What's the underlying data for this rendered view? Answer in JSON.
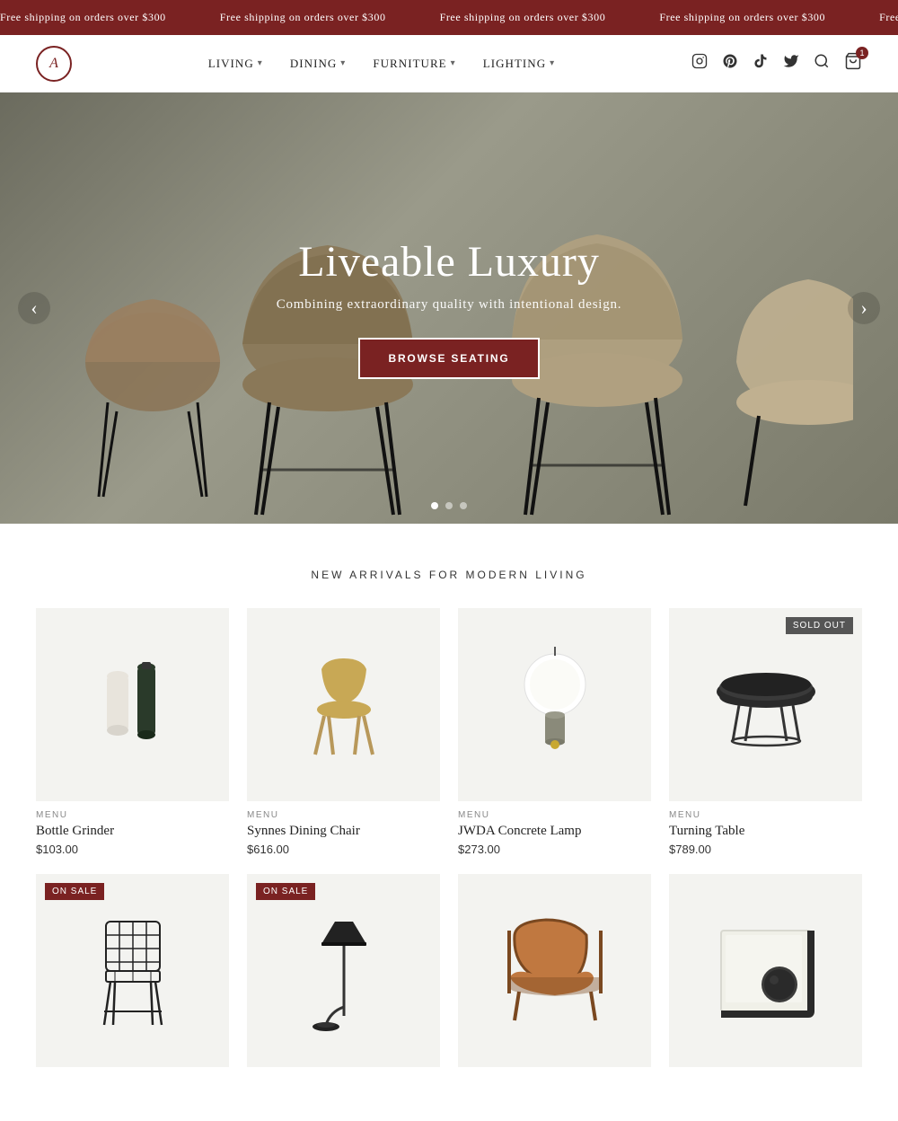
{
  "announcement": {
    "items": [
      "Free shipping on orders over $300",
      "Free shipping on orders over $300",
      "Free shipping on orders over $300",
      "Free shipping on orders over $300",
      "Free shipping"
    ]
  },
  "nav": {
    "logo_letter": "A",
    "links": [
      {
        "label": "LIVING",
        "has_dropdown": true
      },
      {
        "label": "DINING",
        "has_dropdown": true
      },
      {
        "label": "FURNITURE",
        "has_dropdown": true
      },
      {
        "label": "LIGHTING",
        "has_dropdown": true
      }
    ]
  },
  "hero": {
    "title": "Liveable Luxury",
    "subtitle": "Combining extraordinary quality with intentional design.",
    "cta_label": "BROWSE SEATING",
    "slides": 3,
    "active_slide": 0
  },
  "new_arrivals": {
    "section_title": "NEW ARRIVALS FOR MODERN LIVING",
    "products": [
      {
        "brand": "MENU",
        "name": "Bottle Grinder",
        "price": "$103.00",
        "badge": null,
        "icon": "bottle-grinder"
      },
      {
        "brand": "MENU",
        "name": "Synnes Dining Chair",
        "price": "$616.00",
        "badge": null,
        "icon": "dining-chair"
      },
      {
        "brand": "MENU",
        "name": "JWDA Concrete Lamp",
        "price": "$273.00",
        "badge": null,
        "icon": "concrete-lamp"
      },
      {
        "brand": "MENU",
        "name": "Turning Table",
        "price": "$789.00",
        "badge": "SOLD OUT",
        "icon": "turning-table"
      }
    ],
    "products_row2": [
      {
        "brand": null,
        "name": null,
        "price": null,
        "badge": "ON SALE",
        "icon": "wire-chair"
      },
      {
        "brand": null,
        "name": null,
        "price": null,
        "badge": "ON SALE",
        "icon": "floor-lamp"
      },
      {
        "brand": null,
        "name": null,
        "price": null,
        "badge": null,
        "icon": "lounge-chair"
      },
      {
        "brand": null,
        "name": null,
        "price": null,
        "badge": null,
        "icon": "tray"
      }
    ]
  },
  "icons": {
    "search": "🔍",
    "cart": "🛍",
    "cart_count": "1",
    "instagram": "IG",
    "pinterest": "PT",
    "tiktok": "TK",
    "twitter": "TW"
  }
}
